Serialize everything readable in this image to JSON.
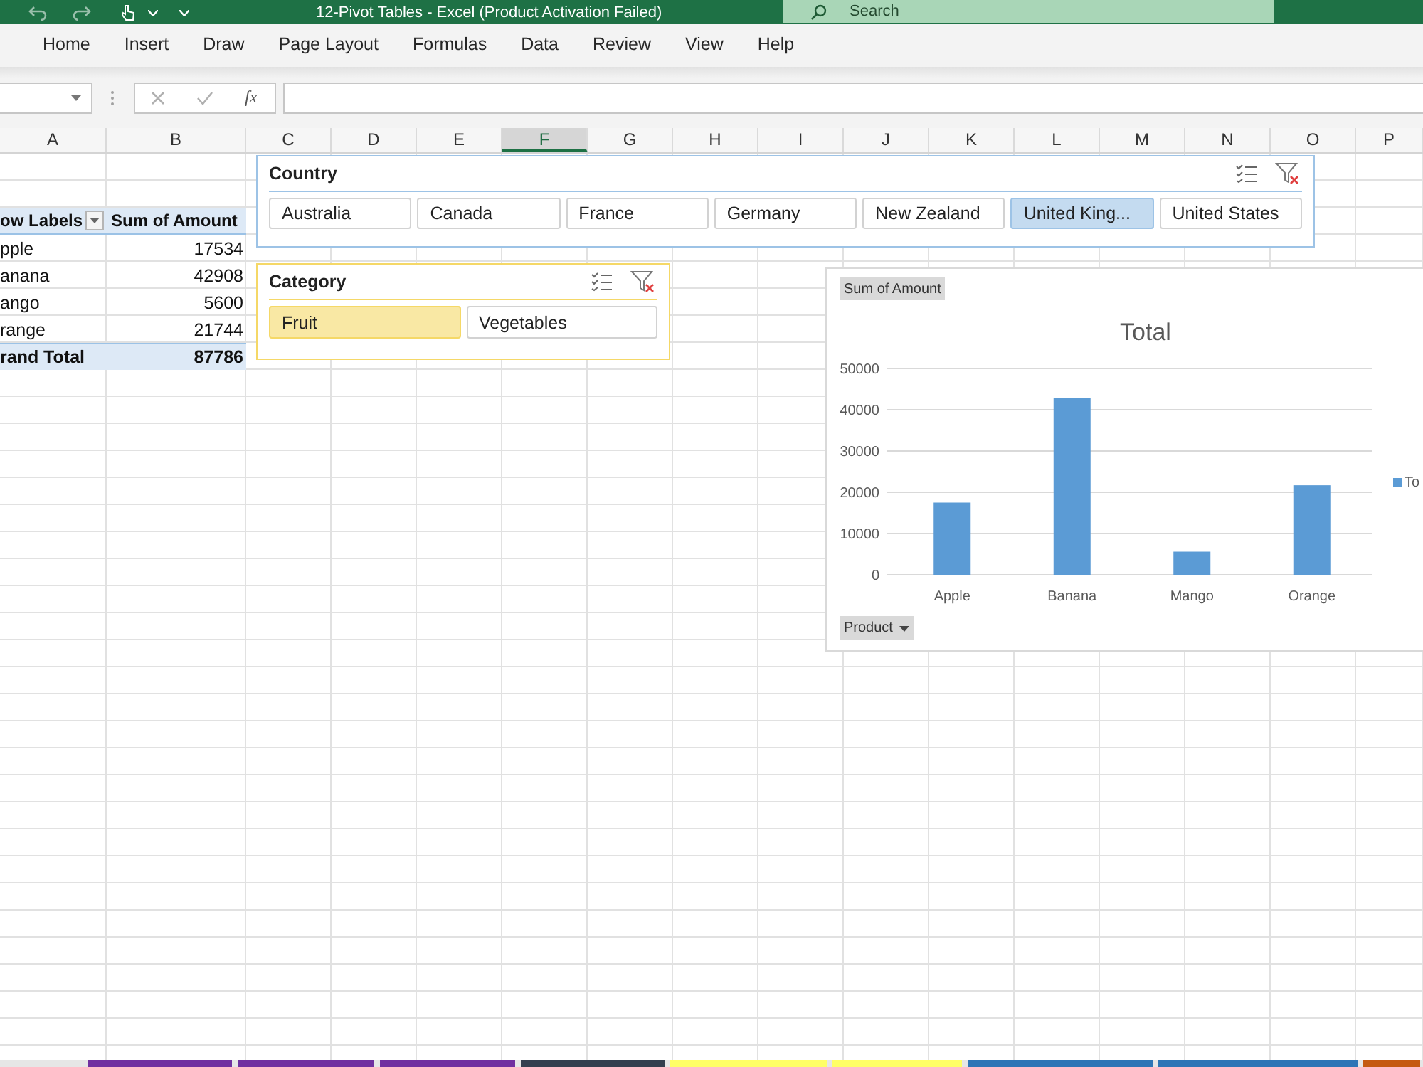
{
  "title_bar": {
    "title": "12-Pivot Tables - Excel (Product Activation Failed)",
    "search": {
      "placeholder": "Search"
    }
  },
  "ribbon": {
    "tabs": [
      {
        "label": "Home",
        "selected": false
      },
      {
        "label": "Insert",
        "selected": false
      },
      {
        "label": "Draw",
        "selected": false
      },
      {
        "label": "Page Layout",
        "selected": false
      },
      {
        "label": "Formulas",
        "selected": false
      },
      {
        "label": "Data",
        "selected": false
      },
      {
        "label": "Review",
        "selected": false
      },
      {
        "label": "View",
        "selected": false
      },
      {
        "label": "Help",
        "selected": false
      }
    ]
  },
  "formula_bar": {
    "function_label": "fx"
  },
  "column_headers": [
    {
      "label": "A",
      "selected": false
    },
    {
      "label": "B",
      "selected": false
    },
    {
      "label": "C",
      "selected": false
    },
    {
      "label": "D",
      "selected": false
    },
    {
      "label": "E",
      "selected": false
    },
    {
      "label": "F",
      "selected": true
    },
    {
      "label": "G",
      "selected": false
    },
    {
      "label": "H",
      "selected": false
    },
    {
      "label": "I",
      "selected": false
    },
    {
      "label": "J",
      "selected": false
    },
    {
      "label": "K",
      "selected": false
    },
    {
      "label": "L",
      "selected": false
    },
    {
      "label": "M",
      "selected": false
    },
    {
      "label": "N",
      "selected": false
    },
    {
      "label": "O",
      "selected": false
    },
    {
      "label": "P",
      "selected": false
    }
  ],
  "pivot_table": {
    "columns": [
      "ow Labels",
      "Sum of Amount"
    ],
    "rows": [
      {
        "label": "pple",
        "value": "17534"
      },
      {
        "label": "anana",
        "value": "42908"
      },
      {
        "label": "ango",
        "value": "5600"
      },
      {
        "label": "range",
        "value": "21744"
      }
    ],
    "total": {
      "label": "rand Total",
      "value": "87786"
    }
  },
  "slicers": [
    {
      "title": "Country",
      "color": "#9dc3e6",
      "items": [
        {
          "label": "Australia",
          "selected": false
        },
        {
          "label": "Canada",
          "selected": false
        },
        {
          "label": "France",
          "selected": false
        },
        {
          "label": "Germany",
          "selected": false
        },
        {
          "label": "New Zealand",
          "selected": false
        },
        {
          "label": "United King...",
          "selected": true
        },
        {
          "label": "United States",
          "selected": false
        }
      ]
    },
    {
      "title": "Category",
      "color": "#f5d867",
      "items": [
        {
          "label": "Fruit",
          "selected": true
        },
        {
          "label": "Vegetables",
          "selected": false
        }
      ]
    }
  ],
  "chart": {
    "value_field": "Sum of Amount",
    "axis_field": "Product",
    "chart_data": {
      "type": "bar",
      "title": "Total",
      "categories": [
        "Apple",
        "Banana",
        "Mango",
        "Orange"
      ],
      "series": [
        {
          "name": "To",
          "color": "#5b9bd5",
          "values": [
            17500,
            42900,
            5600,
            21700
          ]
        }
      ],
      "ylim": [
        0,
        50000
      ],
      "yticks": [
        0,
        10000,
        20000,
        30000,
        40000,
        50000
      ],
      "grid": true
    }
  },
  "sheet_tabs": [
    {
      "color": "#7030a0"
    },
    {
      "color": "#7030a0"
    },
    {
      "color": "#7030a0"
    },
    {
      "color": "#333f4f"
    },
    {
      "color": "#ffff66"
    },
    {
      "color": "#ffff66"
    },
    {
      "color": "#2e75b6"
    },
    {
      "color": "#2e75b6"
    },
    {
      "color": "#c55a11"
    }
  ]
}
